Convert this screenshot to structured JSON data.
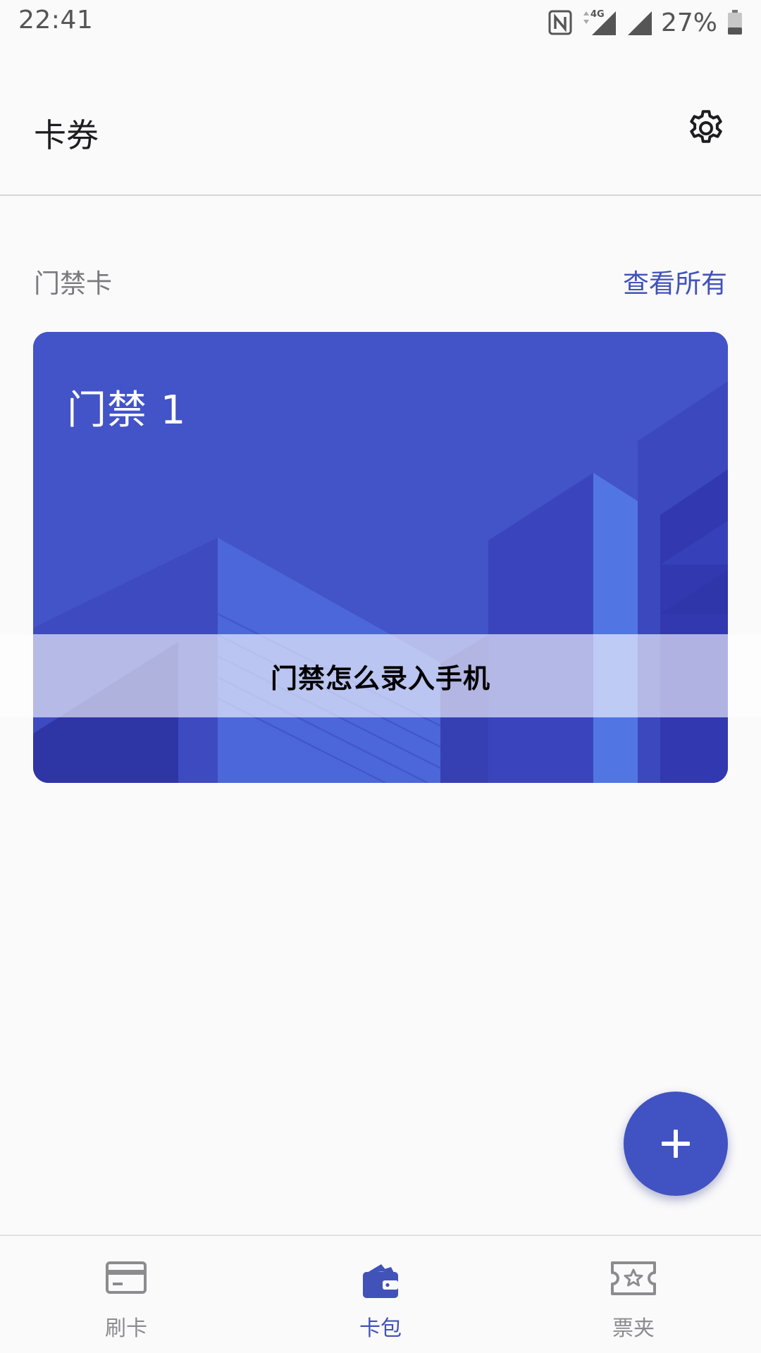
{
  "status_bar": {
    "time": "22:41",
    "network": "4G",
    "battery": "27%"
  },
  "header": {
    "title": "卡券",
    "settings_icon": "gear-icon"
  },
  "section": {
    "title": "门禁卡",
    "view_all": "查看所有"
  },
  "card": {
    "name": "门禁 1",
    "color": "#4353c8"
  },
  "overlay": {
    "text": "门禁怎么录入手机"
  },
  "fab": {
    "icon": "plus-icon",
    "color": "#4152c2"
  },
  "bottom_nav": {
    "items": [
      {
        "label": "刷卡",
        "icon": "card-icon",
        "active": false
      },
      {
        "label": "卡包",
        "icon": "wallet-icon",
        "active": true
      },
      {
        "label": "票夹",
        "icon": "ticket-icon",
        "active": false
      }
    ]
  },
  "colors": {
    "accent": "#4152b8",
    "inactive": "#8c8c8f"
  }
}
